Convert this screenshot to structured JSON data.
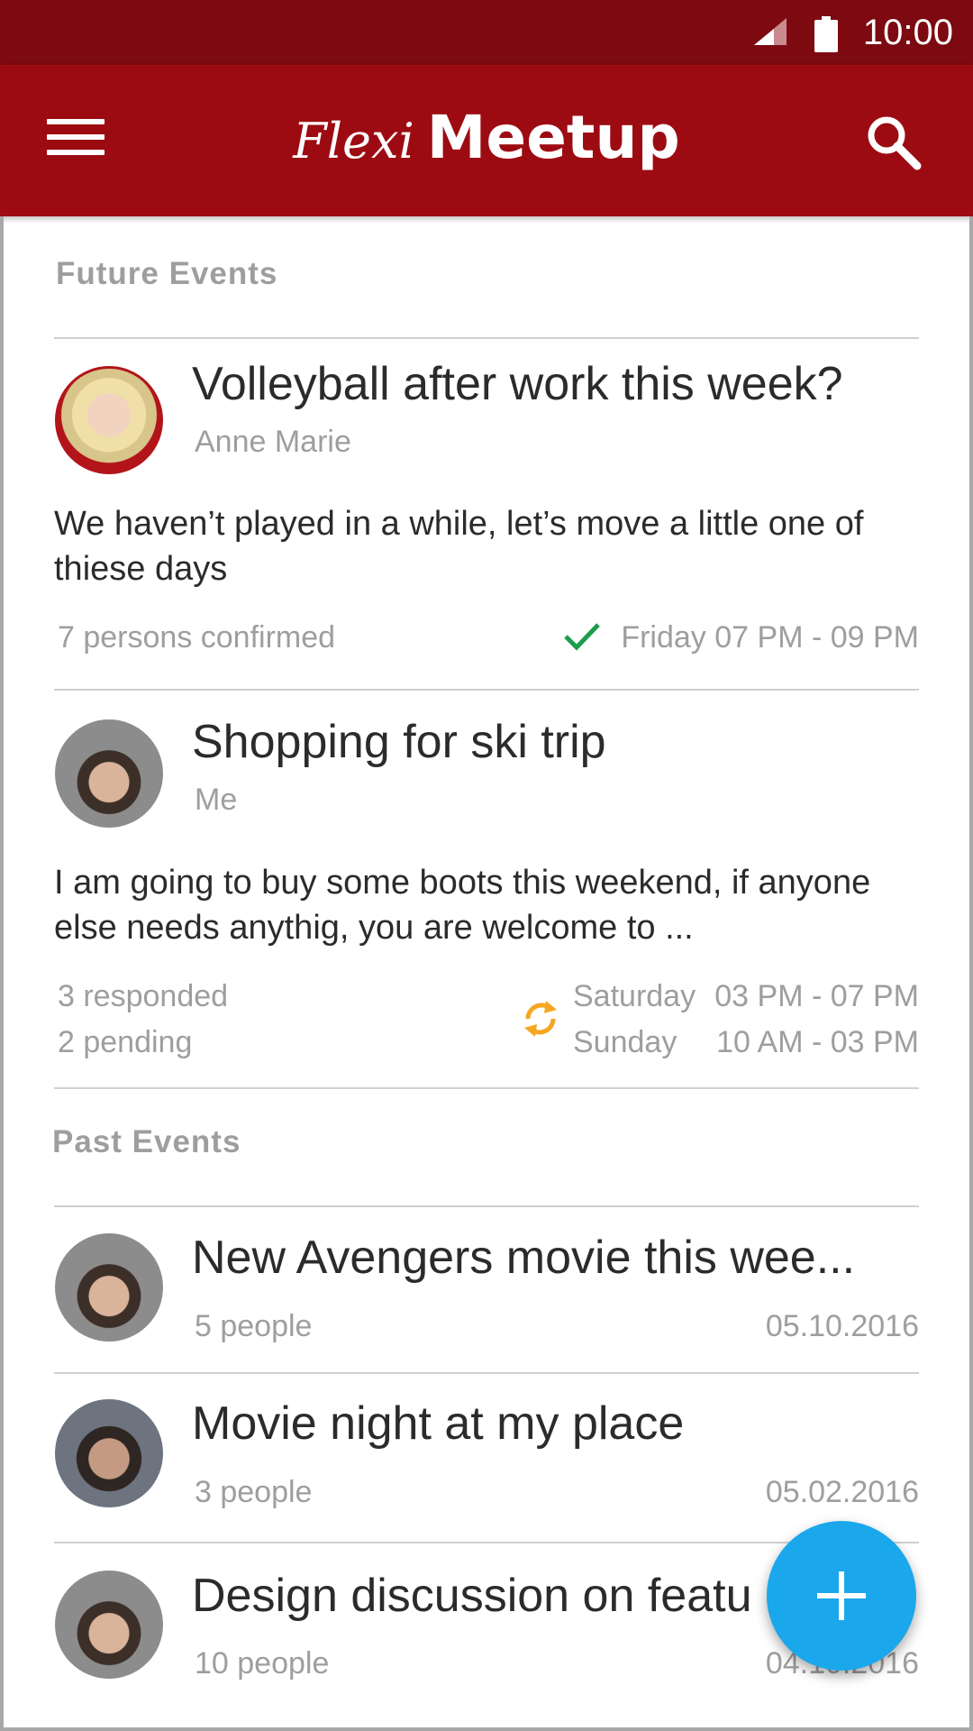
{
  "status_bar": {
    "time": "10:00",
    "signal_icon": "signal-icon",
    "battery_icon": "battery-icon"
  },
  "app_bar": {
    "menu_icon": "menu-icon",
    "title_part1": "Flexi",
    "title_part2": "Meetup",
    "search_icon": "search-icon"
  },
  "colors": {
    "status_bar": "#7c0a10",
    "app_bar": "#9d0b12",
    "fab": "#1aa7ec",
    "confirmed_check": "#1a9e4a",
    "pending_sync": "#f5a623"
  },
  "future_events": {
    "header": "Future Events",
    "events": [
      {
        "title": "Volleyball after work this week?",
        "organizer": "Anne Marie",
        "description": "We haven’t played in a while, let’s move a little one of thiese days",
        "status": "7 persons confirmed",
        "status_icon": "check-icon",
        "time": "Friday 07 PM - 09 PM"
      },
      {
        "title": "Shopping for ski trip",
        "organizer": "Me",
        "description": "I am going to buy some boots this weekend, if anyone else needs anythig, you are welcome to ...",
        "responded": "3 responded",
        "pending": "2 pending",
        "status_icon": "sync-icon",
        "times": [
          {
            "day": "Saturday",
            "hours": "03 PM - 07 PM"
          },
          {
            "day": "Sunday",
            "hours": "10 AM - 03 PM"
          }
        ]
      }
    ]
  },
  "past_events": {
    "header": "Past Events",
    "events": [
      {
        "title": "New Avengers movie this wee...",
        "people": "5 people",
        "date": "05.10.2016"
      },
      {
        "title": "Movie night at my place",
        "people": "3 people",
        "date": "05.02.2016"
      },
      {
        "title": "Design discussion on featu",
        "people": "10 people",
        "date": "04.10.2016"
      }
    ]
  },
  "fab": {
    "icon": "plus-icon"
  }
}
